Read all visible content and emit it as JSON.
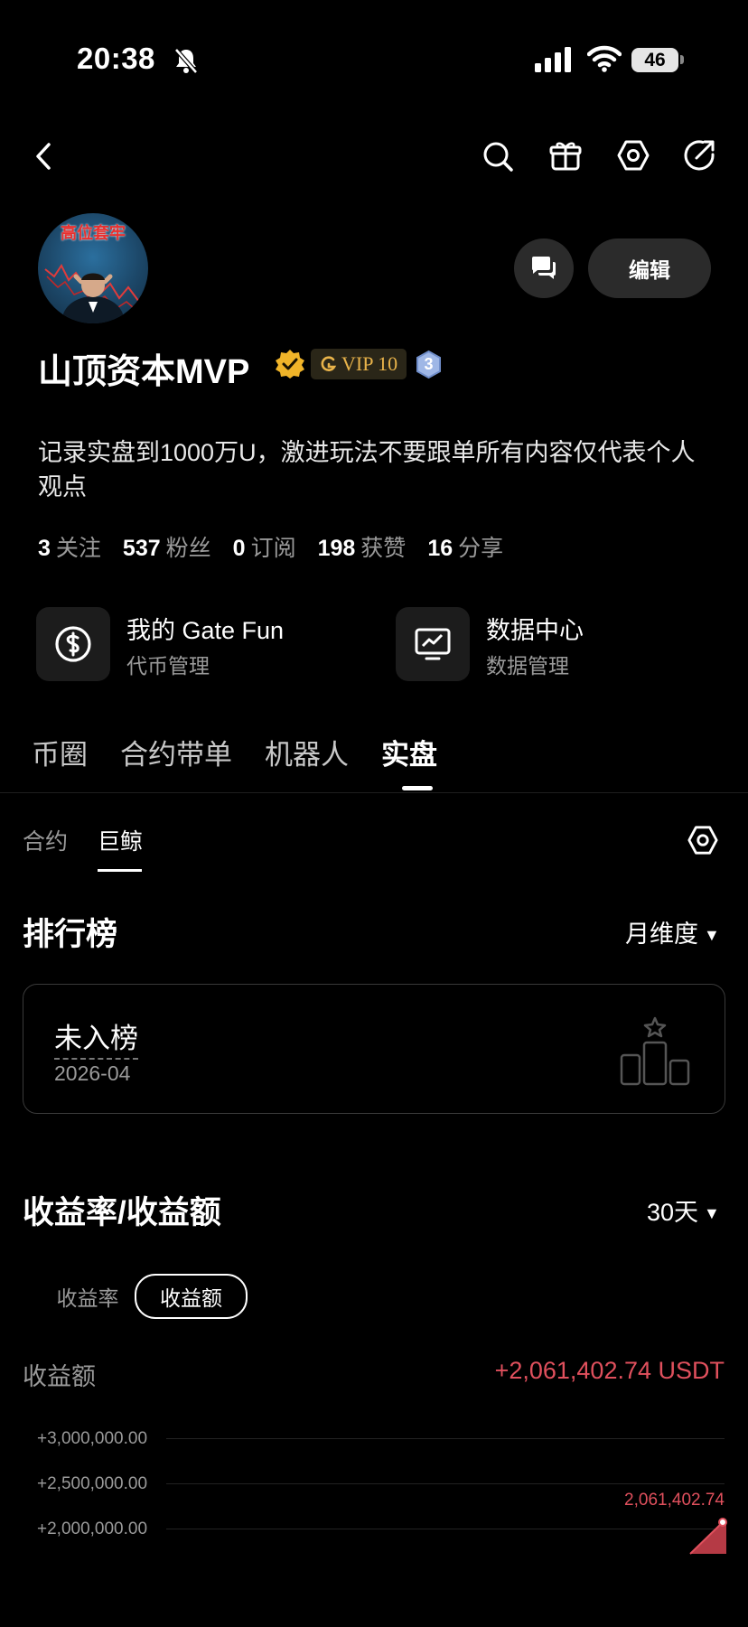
{
  "status_bar": {
    "time": "20:38",
    "battery": "46"
  },
  "profile": {
    "avatar_text": "高位套牢",
    "name": "山顶资本MVP",
    "vip": "VIP 10",
    "level_badge": "3",
    "edit_label": "编辑",
    "bio": "记录实盘到1000万U，激进玩法不要跟单所有内容仅代表个人观点",
    "stats": [
      {
        "value": "3",
        "label": "关注"
      },
      {
        "value": "537",
        "label": "粉丝"
      },
      {
        "value": "0",
        "label": "订阅"
      },
      {
        "value": "198",
        "label": "获赞"
      },
      {
        "value": "16",
        "label": "分享"
      }
    ]
  },
  "cards": [
    {
      "title": "我的 Gate Fun",
      "subtitle": "代币管理",
      "icon": "dollar-coin-icon"
    },
    {
      "title": "数据中心",
      "subtitle": "数据管理",
      "icon": "chart-monitor-icon"
    }
  ],
  "tabs": [
    "币圈",
    "合约带单",
    "机器人",
    "实盘"
  ],
  "active_tab": "实盘",
  "subtabs": [
    "合约",
    "巨鲸"
  ],
  "active_subtab": "巨鲸",
  "ranking": {
    "title": "排行榜",
    "period": "月维度",
    "status": "未入榜",
    "date": "2026-04"
  },
  "returns": {
    "title": "收益率/收益额",
    "period": "30天",
    "toggle": [
      "收益率",
      "收益额"
    ],
    "active_toggle": "收益额",
    "metric_label": "收益额",
    "metric_value": "+2,061,402.74 USDT"
  },
  "colors": {
    "negative": "#e0505d",
    "accent_gold": "#e8b34a"
  },
  "chart_data": {
    "type": "area",
    "y_ticks": [
      "+3,000,000.00",
      "+2,500,000.00",
      "+2,000,000.00"
    ],
    "ylim": [
      2000000,
      3000000
    ],
    "last_value": 2061402.74,
    "last_label": "2,061,402.74"
  }
}
